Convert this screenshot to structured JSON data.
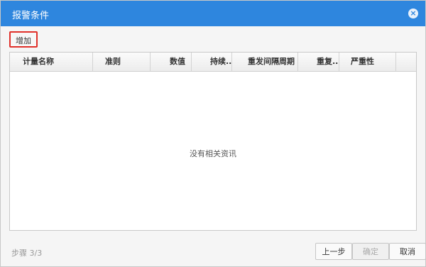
{
  "dialog": {
    "title": "报警条件",
    "close_icon": "×"
  },
  "toolbar": {
    "add_label": "增加"
  },
  "grid": {
    "columns": [
      "计量名称",
      "准则",
      "数值",
      "持续...",
      "重发间隔周期",
      "重复...",
      "严重性"
    ],
    "empty_text": "没有相关资讯"
  },
  "footer": {
    "step_text": "步骤 3/3",
    "prev_label": "上一步",
    "confirm_label": "确定",
    "cancel_label": "取消"
  },
  "colors": {
    "titlebar": "#2e86de",
    "highlight": "#e0302a"
  }
}
